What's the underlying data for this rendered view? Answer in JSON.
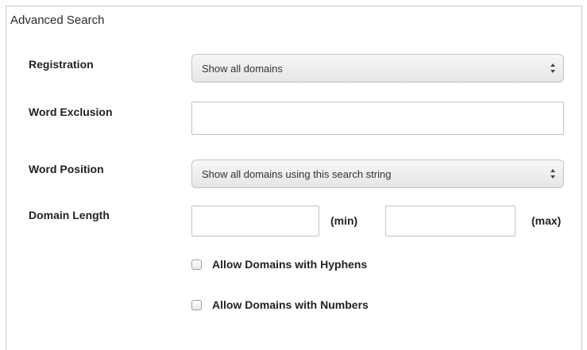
{
  "panel": {
    "title": "Advanced Search"
  },
  "form": {
    "registration": {
      "label": "Registration",
      "selected": "Show all domains",
      "icon": "select-arrows-icon"
    },
    "word_exclusion": {
      "label": "Word Exclusion",
      "value": ""
    },
    "word_position": {
      "label": "Word Position",
      "selected": "Show all domains using this search string",
      "icon": "select-arrows-icon"
    },
    "domain_length": {
      "label": "Domain Length",
      "min_value": "",
      "min_unit": "(min)",
      "max_value": "",
      "max_unit": "(max)"
    },
    "allow_hyphens": {
      "label": "Allow Domains with Hyphens",
      "checked": false
    },
    "allow_numbers": {
      "label": "Allow Domains with Numbers",
      "checked": false
    }
  }
}
